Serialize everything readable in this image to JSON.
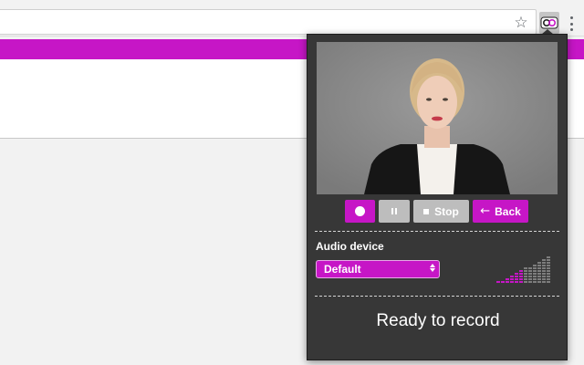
{
  "colors": {
    "brand": "#c616c6",
    "popup_background": "#373737",
    "inactive_button": "#bdbdbd",
    "meter_active": "#c616c6",
    "meter_inactive": "#7d7d7d"
  },
  "browser": {
    "icons": [
      "star-icon",
      "extension-icon",
      "more-menu-icon"
    ]
  },
  "recorder": {
    "preview_icon": "webcam-preview",
    "controls": {
      "record_icon": "record-icon",
      "pause_icon": "pause-icon",
      "stop_label": "Stop",
      "stop_icon": "stop-icon",
      "back_label": "Back",
      "back_icon": "arrow-left-icon"
    },
    "audio": {
      "label": "Audio device",
      "selected_device": "Default"
    },
    "level_meter": {
      "bars": 12,
      "active_bars": 6
    },
    "status": "Ready to record"
  }
}
